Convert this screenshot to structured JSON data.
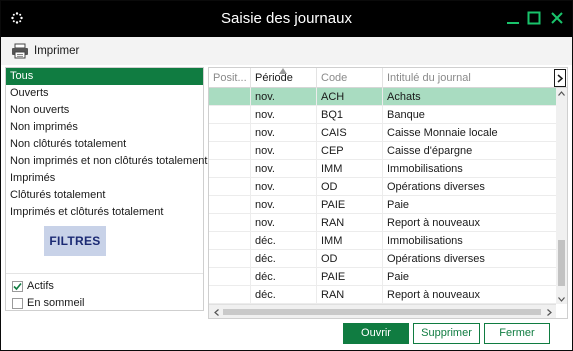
{
  "window": {
    "title": "Saisie des journaux",
    "app_icon": "app-dots-icon",
    "controls": [
      "minimize-icon",
      "maximize-icon",
      "close-icon"
    ],
    "accent_color": "#107c41"
  },
  "toolbar": {
    "print_label": "Imprimer",
    "print_icon": "printer-icon"
  },
  "filters": {
    "items": [
      {
        "label": "Tous",
        "selected": true
      },
      {
        "label": "Ouverts"
      },
      {
        "label": "Non ouverts"
      },
      {
        "label": "Non imprimés"
      },
      {
        "label": "Non clôturés totalement"
      },
      {
        "label": "Non imprimés et non clôturés totalement"
      },
      {
        "label": "Imprimés"
      },
      {
        "label": "Clôturés totalement"
      },
      {
        "label": "Imprimés et clôturés totalement"
      }
    ],
    "logo_text": "FILTRES",
    "checkboxes": [
      {
        "label": "Actifs",
        "checked": true
      },
      {
        "label": "En sommeil",
        "checked": false
      }
    ]
  },
  "grid": {
    "columns": [
      "Posit...",
      "Période",
      "Code",
      "Intitulé du journal"
    ],
    "sorted_column": "Période",
    "rows": [
      {
        "period": "nov.",
        "code": "ACH",
        "label": "Achats",
        "selected": true
      },
      {
        "period": "nov.",
        "code": "BQ1",
        "label": "Banque"
      },
      {
        "period": "nov.",
        "code": "CAIS",
        "label": "Caisse Monnaie locale"
      },
      {
        "period": "nov.",
        "code": "CEP",
        "label": "Caisse d'épargne"
      },
      {
        "period": "nov.",
        "code": "IMM",
        "label": "Immobilisations"
      },
      {
        "period": "nov.",
        "code": "OD",
        "label": "Opérations diverses"
      },
      {
        "period": "nov.",
        "code": "PAIE",
        "label": "Paie"
      },
      {
        "period": "nov.",
        "code": "RAN",
        "label": "Report à nouveaux"
      },
      {
        "period": "déc.",
        "code": "IMM",
        "label": "Immobilisations"
      },
      {
        "period": "déc.",
        "code": "OD",
        "label": "Opérations diverses"
      },
      {
        "period": "déc.",
        "code": "PAIE",
        "label": "Paie"
      },
      {
        "period": "déc.",
        "code": "RAN",
        "label": "Report à nouveaux"
      }
    ]
  },
  "buttons": {
    "open": "Ouvrir",
    "delete": "Supprimer",
    "close": "Fermer"
  }
}
